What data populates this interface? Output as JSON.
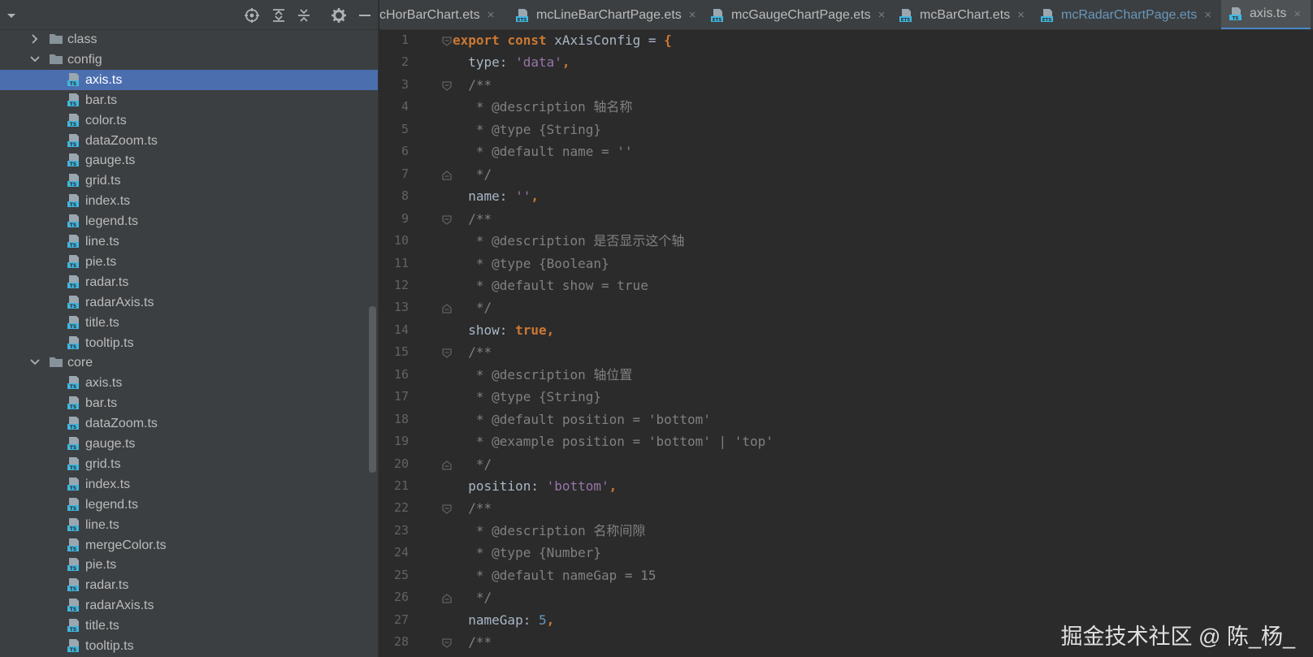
{
  "project_panel": {
    "toolbar_icons": [
      "dropdown-arrow-icon",
      "locate-icon",
      "expand-all-icon",
      "collapse-all-icon",
      "gear-icon",
      "minimize-icon"
    ],
    "tree": [
      {
        "label": "class",
        "kind": "folder",
        "expanded": false,
        "level": 1
      },
      {
        "label": "config",
        "kind": "folder",
        "expanded": true,
        "level": 1
      },
      {
        "label": "axis.ts",
        "kind": "file",
        "level": 2,
        "selected": true
      },
      {
        "label": "bar.ts",
        "kind": "file",
        "level": 2
      },
      {
        "label": "color.ts",
        "kind": "file",
        "level": 2
      },
      {
        "label": "dataZoom.ts",
        "kind": "file",
        "level": 2
      },
      {
        "label": "gauge.ts",
        "kind": "file",
        "level": 2
      },
      {
        "label": "grid.ts",
        "kind": "file",
        "level": 2
      },
      {
        "label": "index.ts",
        "kind": "file",
        "level": 2
      },
      {
        "label": "legend.ts",
        "kind": "file",
        "level": 2
      },
      {
        "label": "line.ts",
        "kind": "file",
        "level": 2
      },
      {
        "label": "pie.ts",
        "kind": "file",
        "level": 2
      },
      {
        "label": "radar.ts",
        "kind": "file",
        "level": 2
      },
      {
        "label": "radarAxis.ts",
        "kind": "file",
        "level": 2
      },
      {
        "label": "title.ts",
        "kind": "file",
        "level": 2
      },
      {
        "label": "tooltip.ts",
        "kind": "file",
        "level": 2
      },
      {
        "label": "core",
        "kind": "folder",
        "expanded": true,
        "level": 1
      },
      {
        "label": "axis.ts",
        "kind": "file",
        "level": 2
      },
      {
        "label": "bar.ts",
        "kind": "file",
        "level": 2
      },
      {
        "label": "dataZoom.ts",
        "kind": "file",
        "level": 2
      },
      {
        "label": "gauge.ts",
        "kind": "file",
        "level": 2
      },
      {
        "label": "grid.ts",
        "kind": "file",
        "level": 2
      },
      {
        "label": "index.ts",
        "kind": "file",
        "level": 2
      },
      {
        "label": "legend.ts",
        "kind": "file",
        "level": 2
      },
      {
        "label": "line.ts",
        "kind": "file",
        "level": 2
      },
      {
        "label": "mergeColor.ts",
        "kind": "file",
        "level": 2
      },
      {
        "label": "pie.ts",
        "kind": "file",
        "level": 2
      },
      {
        "label": "radar.ts",
        "kind": "file",
        "level": 2
      },
      {
        "label": "radarAxis.ts",
        "kind": "file",
        "level": 2
      },
      {
        "label": "title.ts",
        "kind": "file",
        "level": 2
      },
      {
        "label": "tooltip.ts",
        "kind": "file",
        "level": 2
      }
    ]
  },
  "tabs": [
    {
      "label": "cHorBarChart.ets",
      "icon": "ets-file-icon",
      "modified": false,
      "active": false
    },
    {
      "label": "mcLineBarChartPage.ets",
      "icon": "ets-file-icon",
      "modified": false,
      "active": false
    },
    {
      "label": "mcGaugeChartPage.ets",
      "icon": "ets-file-icon",
      "modified": false,
      "active": false
    },
    {
      "label": "mcBarChart.ets",
      "icon": "ets-file-icon",
      "modified": false,
      "active": false
    },
    {
      "label": "mcRadarChartPage.ets",
      "icon": "ets-file-icon",
      "modified": true,
      "active": false
    },
    {
      "label": "axis.ts",
      "icon": "ts-file-icon",
      "modified": false,
      "active": true
    }
  ],
  "tab_close_glyph": "×",
  "editor": {
    "lines": [
      {
        "n": "1",
        "fold": "open",
        "tokens": [
          [
            "kw",
            "export"
          ],
          [
            "pn",
            " "
          ],
          [
            "kw",
            "const"
          ],
          [
            "pn",
            " "
          ],
          [
            "id",
            "xAxisConfig"
          ],
          [
            "pn",
            " = "
          ],
          [
            "kw",
            "{"
          ]
        ]
      },
      {
        "n": "2",
        "tokens": [
          [
            "pn",
            "  "
          ],
          [
            "pr",
            "type"
          ],
          [
            "pn",
            ": "
          ],
          [
            "str",
            "'data'"
          ],
          [
            "kw",
            ","
          ]
        ]
      },
      {
        "n": "3",
        "fold": "open",
        "tokens": [
          [
            "cm",
            "  /**"
          ]
        ]
      },
      {
        "n": "4",
        "tokens": [
          [
            "cm",
            "   * @description 轴名称"
          ]
        ]
      },
      {
        "n": "5",
        "tokens": [
          [
            "cm",
            "   * @type {String}"
          ]
        ]
      },
      {
        "n": "6",
        "tokens": [
          [
            "cm",
            "   * @default name = ''"
          ]
        ]
      },
      {
        "n": "7",
        "fold": "close",
        "tokens": [
          [
            "cm",
            "   */"
          ]
        ]
      },
      {
        "n": "8",
        "tokens": [
          [
            "pn",
            "  "
          ],
          [
            "pr",
            "name"
          ],
          [
            "pn",
            ": "
          ],
          [
            "str",
            "''"
          ],
          [
            "kw",
            ","
          ]
        ]
      },
      {
        "n": "9",
        "fold": "open",
        "tokens": [
          [
            "cm",
            "  /**"
          ]
        ]
      },
      {
        "n": "10",
        "tokens": [
          [
            "cm",
            "   * @description 是否显示这个轴"
          ]
        ]
      },
      {
        "n": "11",
        "tokens": [
          [
            "cm",
            "   * @type {Boolean}"
          ]
        ]
      },
      {
        "n": "12",
        "tokens": [
          [
            "cm",
            "   * @default show = true"
          ]
        ]
      },
      {
        "n": "13",
        "fold": "close",
        "tokens": [
          [
            "cm",
            "   */"
          ]
        ]
      },
      {
        "n": "14",
        "tokens": [
          [
            "pn",
            "  "
          ],
          [
            "pr",
            "show"
          ],
          [
            "pn",
            ": "
          ],
          [
            "bool",
            "true"
          ],
          [
            "kw",
            ","
          ]
        ]
      },
      {
        "n": "15",
        "fold": "open",
        "tokens": [
          [
            "cm",
            "  /**"
          ]
        ]
      },
      {
        "n": "16",
        "tokens": [
          [
            "cm",
            "   * @description 轴位置"
          ]
        ]
      },
      {
        "n": "17",
        "tokens": [
          [
            "cm",
            "   * @type {String}"
          ]
        ]
      },
      {
        "n": "18",
        "tokens": [
          [
            "cm",
            "   * @default position = 'bottom'"
          ]
        ]
      },
      {
        "n": "19",
        "tokens": [
          [
            "cm",
            "   * @example position = 'bottom' | 'top'"
          ]
        ]
      },
      {
        "n": "20",
        "fold": "close",
        "tokens": [
          [
            "cm",
            "   */"
          ]
        ]
      },
      {
        "n": "21",
        "tokens": [
          [
            "pn",
            "  "
          ],
          [
            "pr",
            "position"
          ],
          [
            "pn",
            ": "
          ],
          [
            "str",
            "'bottom'"
          ],
          [
            "kw",
            ","
          ]
        ]
      },
      {
        "n": "22",
        "fold": "open",
        "tokens": [
          [
            "cm",
            "  /**"
          ]
        ]
      },
      {
        "n": "23",
        "tokens": [
          [
            "cm",
            "   * @description 名称间隙"
          ]
        ]
      },
      {
        "n": "24",
        "tokens": [
          [
            "cm",
            "   * @type {Number}"
          ]
        ]
      },
      {
        "n": "25",
        "tokens": [
          [
            "cm",
            "   * @default nameGap = 15"
          ]
        ]
      },
      {
        "n": "26",
        "fold": "close",
        "tokens": [
          [
            "cm",
            "   */"
          ]
        ]
      },
      {
        "n": "27",
        "tokens": [
          [
            "pn",
            "  "
          ],
          [
            "pr",
            "nameGap"
          ],
          [
            "pn",
            ": "
          ],
          [
            "num",
            "5"
          ],
          [
            "kw",
            ","
          ]
        ]
      },
      {
        "n": "28",
        "fold": "open",
        "tokens": [
          [
            "cm",
            "  /**"
          ]
        ]
      }
    ]
  },
  "watermark": "掘金技术社区 @ 陈_杨_",
  "colors": {
    "panel_bg": "#3c3f41",
    "editor_bg": "#2b2b2b",
    "selection": "#4b6eaf",
    "keyword": "#cc7832",
    "string": "#9876aa",
    "comment": "#808080",
    "number": "#6897bb",
    "active_tab_underline": "#4a88c7"
  }
}
